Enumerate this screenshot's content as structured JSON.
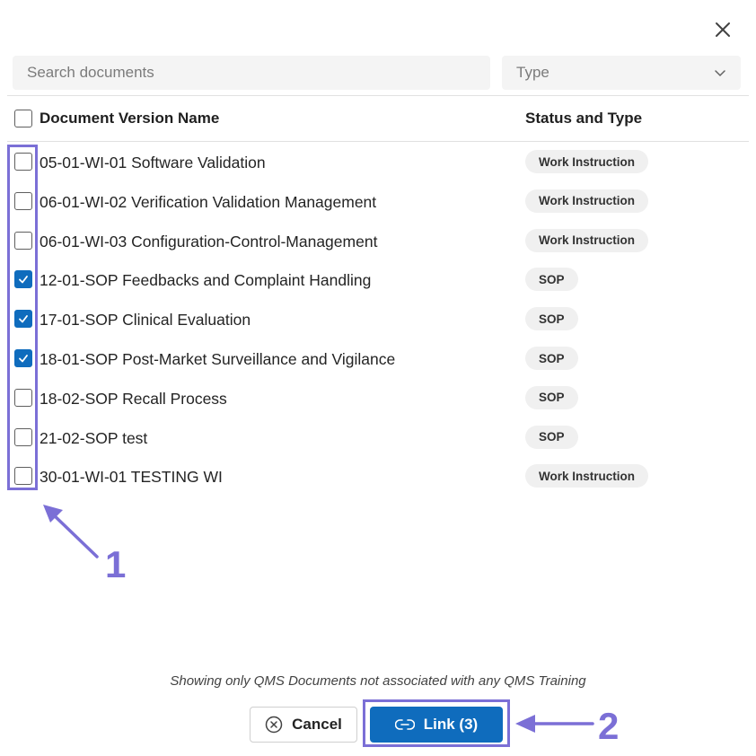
{
  "dialog": {
    "close_icon": "close-icon"
  },
  "filters": {
    "search_placeholder": "Search documents",
    "type_placeholder": "Type"
  },
  "table": {
    "headers": {
      "name": "Document Version Name",
      "status": "Status and Type"
    },
    "header_checked": false,
    "rows": [
      {
        "name": "05-01-WI-01 Software Validation",
        "type": "Work Instruction",
        "checked": false
      },
      {
        "name": "06-01-WI-02 Verification Validation Management",
        "type": "Work Instruction",
        "checked": false
      },
      {
        "name": "06-01-WI-03 Configuration-Control-Management",
        "type": "Work Instruction",
        "checked": false
      },
      {
        "name": "12-01-SOP Feedbacks and Complaint Handling",
        "type": "SOP",
        "checked": true
      },
      {
        "name": "17-01-SOP Clinical Evaluation",
        "type": "SOP",
        "checked": true
      },
      {
        "name": "18-01-SOP Post-Market Surveillance and Vigilance",
        "type": "SOP",
        "checked": true
      },
      {
        "name": "18-02-SOP Recall Process",
        "type": "SOP",
        "checked": false
      },
      {
        "name": "21-02-SOP test",
        "type": "SOP",
        "checked": false
      },
      {
        "name": "30-01-WI-01 TESTING WI",
        "type": "Work Instruction",
        "checked": false
      }
    ]
  },
  "footer": {
    "note": "Showing only QMS Documents not associated with any QMS Training",
    "cancel_label": "Cancel",
    "link_label": "Link (3)"
  },
  "annotations": {
    "label_1": "1",
    "label_2": "2",
    "color": "#7b6fd6"
  },
  "colors": {
    "accent": "#0f6cbd",
    "badge_bg": "#f0f0f0",
    "input_bg": "#f4f4f4"
  }
}
